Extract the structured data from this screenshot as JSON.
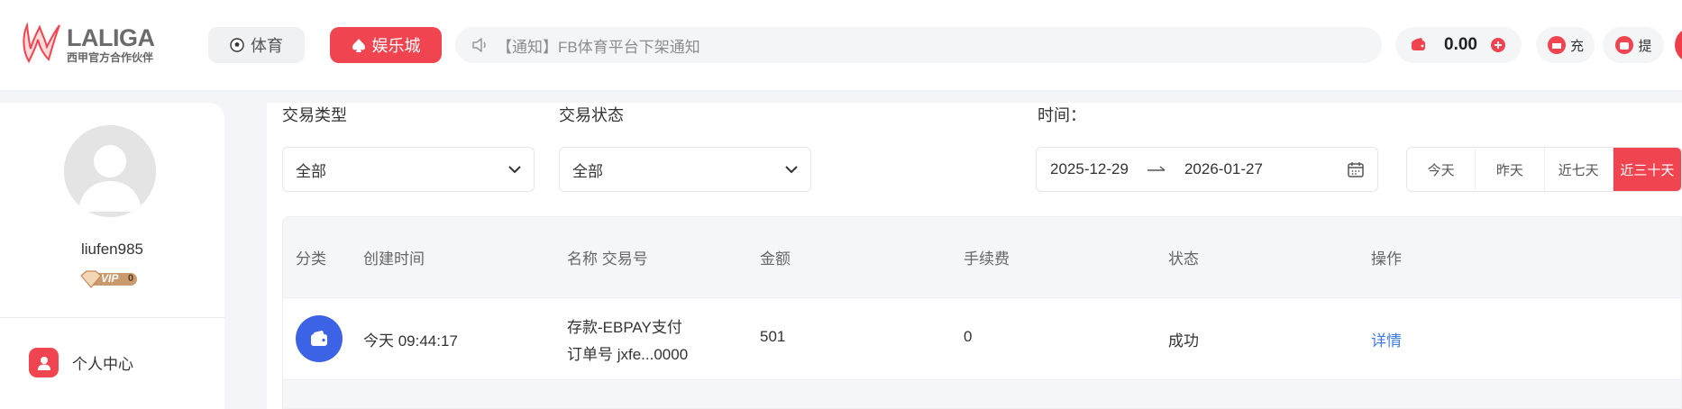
{
  "header": {
    "logo_text": "LALIGA",
    "logo_subtitle": "西甲官方合作伙伴",
    "nav": [
      {
        "label": "体育",
        "icon": "soccer-ball-icon"
      },
      {
        "label": "娱乐城",
        "icon": "spade-icon"
      }
    ],
    "notice_text": "【通知】FB体育平台下架通知",
    "balance": "0.00",
    "deposit_label": "充",
    "withdraw_label": "提"
  },
  "sidebar": {
    "username": "liufen985",
    "vip_label": "VIP",
    "vip_level": "0",
    "items": [
      {
        "label": "个人中心",
        "icon": "user-icon"
      }
    ]
  },
  "filters": {
    "type_label": "交易类型",
    "type_value": "全部",
    "status_label": "交易状态",
    "status_value": "全部",
    "time_label": "时间：",
    "date_start": "2025-12-29",
    "date_end": "2026-01-27",
    "quick_ranges": [
      "今天",
      "昨天",
      "近七天",
      "近三十天"
    ],
    "active_range": "近三十天"
  },
  "table": {
    "columns": [
      "分类",
      "创建时间",
      "名称 交易号",
      "金额",
      "手续费",
      "状态",
      "操作"
    ],
    "rows": [
      {
        "category_icon": "wallet-icon",
        "created": "今天 09:44:17",
        "name": "存款-EBPAY支付",
        "order_no": "订单号 jxfe...0000",
        "amount": "501",
        "fee": "0",
        "status": "成功",
        "action": "详情"
      }
    ]
  },
  "colors": {
    "accent": "#f04550",
    "link": "#3f7de0",
    "category_icon_bg": "#3c63e6"
  }
}
